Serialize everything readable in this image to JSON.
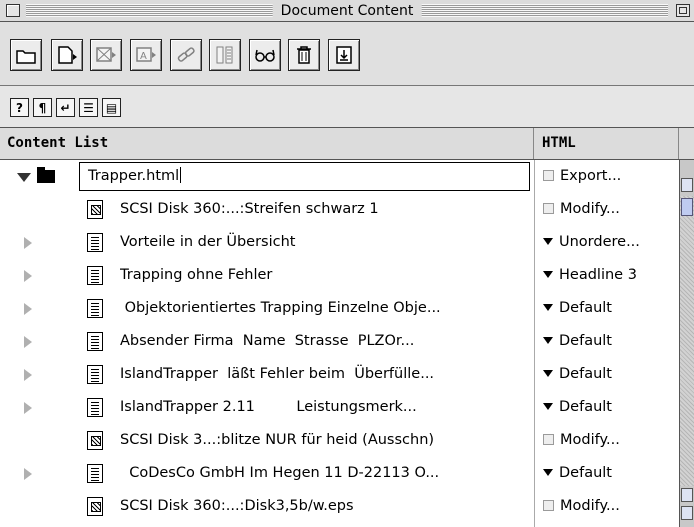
{
  "window": {
    "title": "Document Content"
  },
  "toolbar": {
    "buttons": [
      "folder-icon",
      "new-page-icon",
      "image-placeholder-icon",
      "text-placeholder-icon",
      "link-icon",
      "column-icon",
      "glasses-icon",
      "trash-icon",
      "export-icon"
    ],
    "small_buttons": [
      {
        "icon": "help-icon",
        "glyph": "?"
      },
      {
        "icon": "paragraph-icon",
        "glyph": "¶"
      },
      {
        "icon": "return-icon",
        "glyph": "↵"
      },
      {
        "icon": "list-icon",
        "glyph": "☰"
      },
      {
        "icon": "page-icon",
        "glyph": "▤"
      }
    ]
  },
  "columns": {
    "content": "Content List",
    "html": "HTML"
  },
  "rows": [
    {
      "kind": "folder",
      "label": "Trapper.html",
      "html": "Export...",
      "control": "checkbox",
      "editing": true,
      "expanded": true
    },
    {
      "kind": "image",
      "label": "SCSI Disk 360:...:Streifen schwarz 1",
      "html": "Modify...",
      "control": "checkbox"
    },
    {
      "kind": "text",
      "label": "Vorteile in der Übersicht",
      "html": "Unordere...",
      "control": "popup",
      "triangle": true
    },
    {
      "kind": "text",
      "label": "Trapping ohne Fehler",
      "html": "Headline 3",
      "control": "popup",
      "triangle": true
    },
    {
      "kind": "text",
      "label": " Objektorientiertes Trapping Einzelne Obje...",
      "html": "Default",
      "control": "popup",
      "triangle": true
    },
    {
      "kind": "text",
      "label": "Absender Firma  Name  Strasse  PLZOr...",
      "html": "Default",
      "control": "popup",
      "triangle": true
    },
    {
      "kind": "text",
      "label": "IslandTrapper  läßt Fehler beim  Überfülle...",
      "html": "Default",
      "control": "popup",
      "triangle": true
    },
    {
      "kind": "text",
      "label": "IslandTrapper 2.11         Leistungsmerk...",
      "html": "Default",
      "control": "popup",
      "triangle": true
    },
    {
      "kind": "image",
      "label": "SCSI Disk 3...:blitze NUR für heid (Ausschn)",
      "html": "Modify...",
      "control": "checkbox"
    },
    {
      "kind": "text",
      "label": "  CoDesCo GmbH Im Hegen 11 D-22113 O...",
      "html": "Default",
      "control": "popup",
      "triangle": true
    },
    {
      "kind": "image",
      "label": "SCSI Disk 360:...:Disk3,5b/w.eps",
      "html": "Modify...",
      "control": "checkbox"
    }
  ]
}
